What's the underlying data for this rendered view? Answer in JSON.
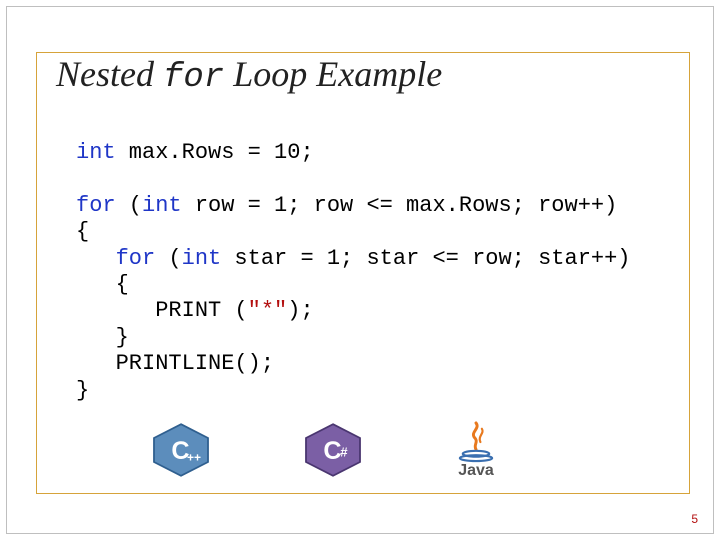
{
  "title": {
    "pre": "Nested ",
    "for_kw": "for",
    "post": " Loop Example"
  },
  "code": {
    "l1_kw": "int",
    "l1_rest": " max.Rows = 10;",
    "l2_kw": "for",
    "l2_a": " (",
    "l2_kw2": "int",
    "l2_rest": " row = 1; row <= max.Rows; row++)",
    "l3": "{",
    "l4_indent": "   ",
    "l4_kw": "for",
    "l4_a": " (",
    "l4_kw2": "int",
    "l4_rest": " star = 1; star <= row; star++)",
    "l5": "   {",
    "l6_a": "      PRINT (",
    "l6_str": "\"*\"",
    "l6_b": ");",
    "l7": "   }",
    "l8": "   PRINTLINE();",
    "l9": "}"
  },
  "logos": {
    "cpp": "++",
    "csharp": "#",
    "java": "Java"
  },
  "page_number": "5"
}
